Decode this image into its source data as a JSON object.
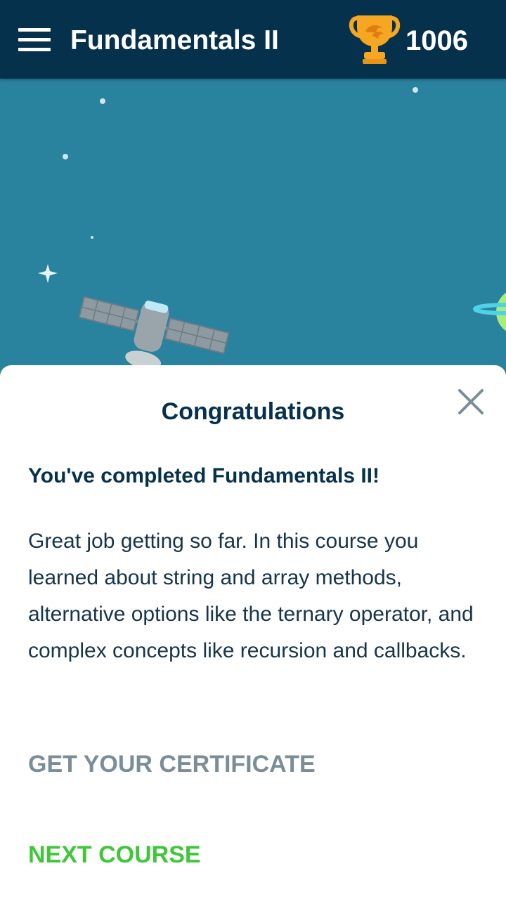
{
  "header": {
    "title": "Fundamentals II",
    "score": "1006",
    "menu_icon": "hamburger-menu-icon",
    "score_icon": "trophy-icon"
  },
  "dialog": {
    "title": "Congratulations",
    "subtitle": "You've completed Fundamentals II!",
    "body": "Great job getting so far. In this course you learned about string and array methods, alternative options like the ternary operator, and complex concepts like recursion and callbacks.",
    "certificate_label": "GET YOUR CERTIFICATE",
    "next_label": "NEXT COURSE",
    "close_icon": "close-icon"
  },
  "colors": {
    "header_bg": "#05314d",
    "scene_bg": "#29829e",
    "text_dark": "#05314d",
    "certificate_gray": "#7a8d98",
    "next_green": "#3fc739",
    "trophy_gold": "#f5a623"
  }
}
